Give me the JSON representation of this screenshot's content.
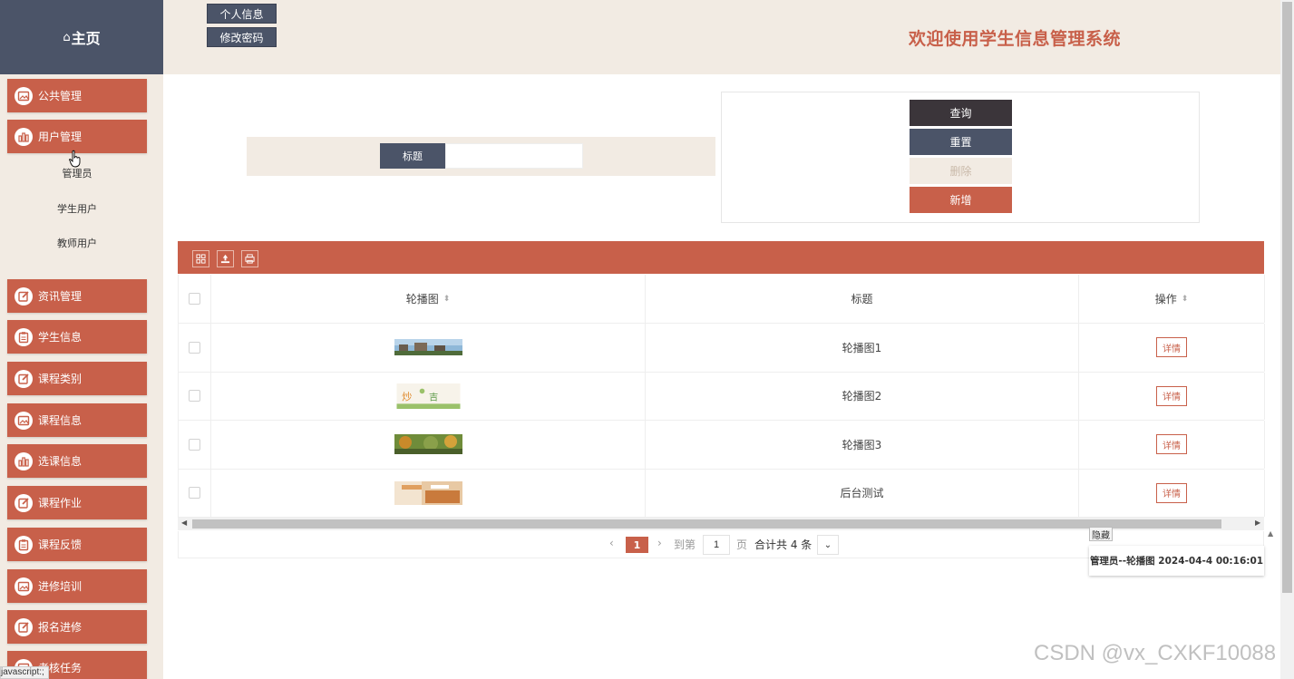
{
  "sidebar": {
    "home_label": "主页",
    "menu": [
      {
        "label": "公共管理",
        "icon": "image-icon"
      },
      {
        "label": "用户管理",
        "icon": "bar-chart-icon"
      },
      {
        "label": "资讯管理",
        "icon": "edit-icon"
      },
      {
        "label": "学生信息",
        "icon": "clipboard-icon"
      },
      {
        "label": "课程类别",
        "icon": "edit-icon"
      },
      {
        "label": "课程信息",
        "icon": "image-icon"
      },
      {
        "label": "选课信息",
        "icon": "bar-chart-icon"
      },
      {
        "label": "课程作业",
        "icon": "edit-icon"
      },
      {
        "label": "课程反馈",
        "icon": "clipboard-icon"
      },
      {
        "label": "进修培训",
        "icon": "image-icon"
      },
      {
        "label": "报名进修",
        "icon": "edit-icon"
      },
      {
        "label": "考核任务",
        "icon": "image-icon"
      }
    ],
    "submenu": [
      "管理员",
      "学生用户",
      "教师用户"
    ]
  },
  "header": {
    "personal_info": "个人信息",
    "change_password": "修改密码",
    "system_title": "欢迎使用学生信息管理系统"
  },
  "search": {
    "label": "标题",
    "value": ""
  },
  "actions": {
    "query": "查询",
    "reset": "重置",
    "delete": "删除",
    "add": "新增"
  },
  "table": {
    "headers": {
      "image": "轮播图",
      "title": "标题",
      "action": "操作"
    },
    "rows": [
      {
        "title": "轮播图1",
        "action": "详情"
      },
      {
        "title": "轮播图2",
        "action": "详情"
      },
      {
        "title": "轮播图3",
        "action": "详情"
      },
      {
        "title": "后台测试",
        "action": "详情"
      }
    ]
  },
  "pagination": {
    "current_page": "1",
    "goto_label": "到第",
    "page_input": "1",
    "page_unit": "页",
    "total_text": "合计共 4 条"
  },
  "notification": {
    "hide_label": "隐藏",
    "message": "管理员--轮播图 2024-04-4 00:16:01"
  },
  "status_bar": "javascript:;",
  "watermark": "CSDN @vx_CXKF10088",
  "colors": {
    "primary": "#c8604a",
    "dark": "#4b5468",
    "cream": "#f2ebe3"
  }
}
